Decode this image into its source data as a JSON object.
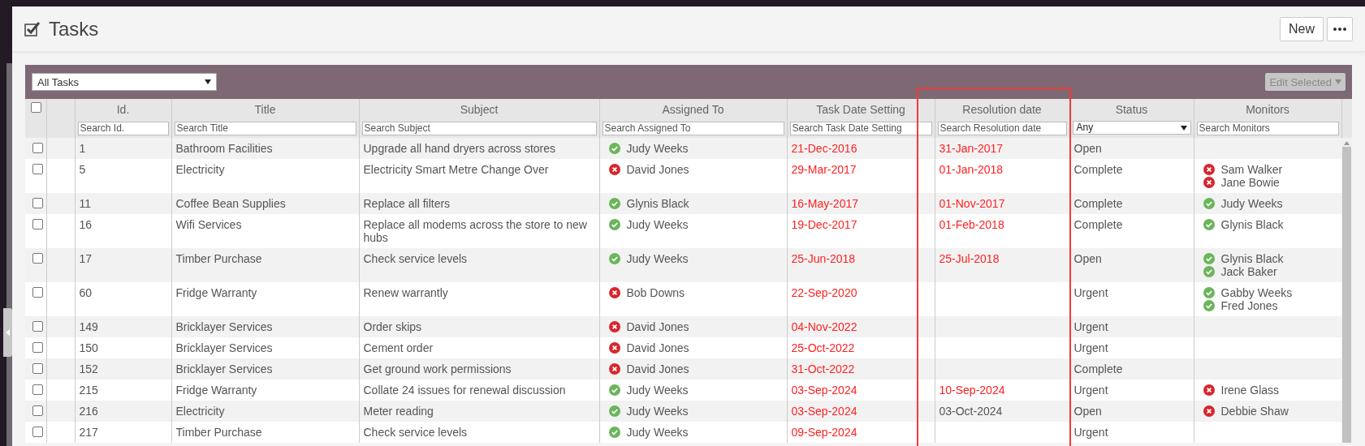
{
  "window": {
    "title": "Tasks"
  },
  "header_actions": {
    "new_button": "New"
  },
  "toolbar": {
    "view_select": "All Tasks",
    "edit_button": {
      "label": "Edit Selected",
      "disabled": true
    }
  },
  "select_all": {
    "checked": false
  },
  "columns": [
    {
      "label": "Id.",
      "filter": {
        "kind": "text",
        "placeholder": "Search Id."
      },
      "highlighted": false
    },
    {
      "label": "Title",
      "filter": {
        "kind": "text",
        "placeholder": "Search Title"
      },
      "highlighted": false
    },
    {
      "label": "Subject",
      "filter": {
        "kind": "text",
        "placeholder": "Search Subject"
      },
      "highlighted": false
    },
    {
      "label": "Assigned To",
      "filter": {
        "kind": "text",
        "placeholder": "Search Assigned To"
      },
      "highlighted": false
    },
    {
      "label": "Task Date Setting",
      "filter": {
        "kind": "text",
        "placeholder": "Search Task Date Setting"
      },
      "highlighted": false
    },
    {
      "label": "Resolution date",
      "filter": {
        "kind": "text",
        "placeholder": "Search Resolution date"
      },
      "highlighted": true
    },
    {
      "label": "Status",
      "filter": {
        "kind": "select",
        "value": "Any"
      },
      "highlighted": false
    },
    {
      "label": "Monitors",
      "filter": {
        "kind": "text",
        "placeholder": "Search Monitors"
      },
      "highlighted": false
    }
  ],
  "rows": [
    {
      "checked": false,
      "id": "1",
      "title": "Bathroom Facilities",
      "subject": "Upgrade all hand dryers across stores",
      "assigned": {
        "name": "Judy Weeks",
        "ok": true
      },
      "task_date": {
        "text": "21-Dec-2016",
        "overdue": true
      },
      "resolution_date": {
        "text": "31-Jan-2017",
        "overdue": true
      },
      "status": "Open",
      "monitors": []
    },
    {
      "checked": false,
      "id": "5",
      "title": "Electricity",
      "subject": "Electricity Smart Metre Change Over",
      "assigned": {
        "name": "David Jones",
        "ok": false
      },
      "task_date": {
        "text": "29-Mar-2017",
        "overdue": true
      },
      "resolution_date": {
        "text": "01-Jan-2018",
        "overdue": true
      },
      "status": "Complete",
      "monitors": [
        {
          "name": "Sam Walker",
          "ok": false
        },
        {
          "name": "Jane Bowie",
          "ok": false
        }
      ]
    },
    {
      "checked": false,
      "id": "11",
      "title": "Coffee Bean Supplies",
      "subject": "Replace all filters",
      "assigned": {
        "name": "Glynis Black",
        "ok": true
      },
      "task_date": {
        "text": "16-May-2017",
        "overdue": true
      },
      "resolution_date": {
        "text": "01-Nov-2017",
        "overdue": true
      },
      "status": "Complete",
      "monitors": [
        {
          "name": "Judy Weeks",
          "ok": true
        }
      ]
    },
    {
      "checked": false,
      "id": "16",
      "title": "Wifi Services",
      "subject": "Replace all modems across the store to new hubs",
      "assigned": {
        "name": "Judy Weeks",
        "ok": true
      },
      "task_date": {
        "text": "19-Dec-2017",
        "overdue": true
      },
      "resolution_date": {
        "text": "01-Feb-2018",
        "overdue": true
      },
      "status": "Complete",
      "monitors": [
        {
          "name": "Glynis Black",
          "ok": true
        }
      ]
    },
    {
      "checked": false,
      "id": "17",
      "title": "Timber Purchase",
      "subject": "Check service levels",
      "assigned": {
        "name": "Judy Weeks",
        "ok": true
      },
      "task_date": {
        "text": "25-Jun-2018",
        "overdue": true
      },
      "resolution_date": {
        "text": "25-Jul-2018",
        "overdue": true
      },
      "status": "Open",
      "monitors": [
        {
          "name": "Glynis Black",
          "ok": true
        },
        {
          "name": "Jack Baker",
          "ok": true
        }
      ]
    },
    {
      "checked": false,
      "id": "60",
      "title": "Fridge Warranty",
      "subject": "Renew warrantly",
      "assigned": {
        "name": "Bob Downs",
        "ok": false
      },
      "task_date": {
        "text": "22-Sep-2020",
        "overdue": true
      },
      "status": "Urgent",
      "monitors": [
        {
          "name": "Gabby Weeks",
          "ok": true
        },
        {
          "name": "Fred Jones",
          "ok": true
        }
      ]
    },
    {
      "checked": false,
      "id": "149",
      "title": "Bricklayer Services",
      "subject": "Order skips",
      "assigned": {
        "name": "David Jones",
        "ok": false
      },
      "task_date": {
        "text": "04-Nov-2022",
        "overdue": true
      },
      "status": "Urgent",
      "monitors": []
    },
    {
      "checked": false,
      "id": "150",
      "title": "Bricklayer Services",
      "subject": "Cement order",
      "assigned": {
        "name": "David Jones",
        "ok": false
      },
      "task_date": {
        "text": "25-Oct-2022",
        "overdue": true
      },
      "status": "Urgent",
      "monitors": []
    },
    {
      "checked": false,
      "id": "152",
      "title": "Bricklayer Services",
      "subject": "Get ground work permissions",
      "assigned": {
        "name": "David Jones",
        "ok": false
      },
      "task_date": {
        "text": "31-Oct-2022",
        "overdue": true
      },
      "status": "Complete",
      "monitors": []
    },
    {
      "checked": false,
      "id": "215",
      "title": "Fridge Warranty",
      "subject": "Collate 24 issues for renewal discussion",
      "assigned": {
        "name": "Judy Weeks",
        "ok": true
      },
      "task_date": {
        "text": "03-Sep-2024",
        "overdue": true
      },
      "resolution_date": {
        "text": "10-Sep-2024",
        "overdue": true
      },
      "status": "Urgent",
      "monitors": [
        {
          "name": "Irene Glass",
          "ok": false
        }
      ]
    },
    {
      "checked": false,
      "id": "216",
      "title": "Electricity",
      "subject": "Meter reading",
      "assigned": {
        "name": "Judy Weeks",
        "ok": true
      },
      "task_date": {
        "text": "03-Sep-2024",
        "overdue": true
      },
      "resolution_date": {
        "text": "03-Oct-2024",
        "overdue": false
      },
      "status": "Open",
      "monitors": [
        {
          "name": "Debbie Shaw",
          "ok": false
        }
      ]
    },
    {
      "checked": false,
      "id": "217",
      "title": "Timber Purchase",
      "subject": "Check service levels",
      "assigned": {
        "name": "Judy Weeks",
        "ok": true
      },
      "task_date": {
        "text": "09-Sep-2024",
        "overdue": true
      },
      "status": "Urgent",
      "monitors": []
    }
  ]
}
